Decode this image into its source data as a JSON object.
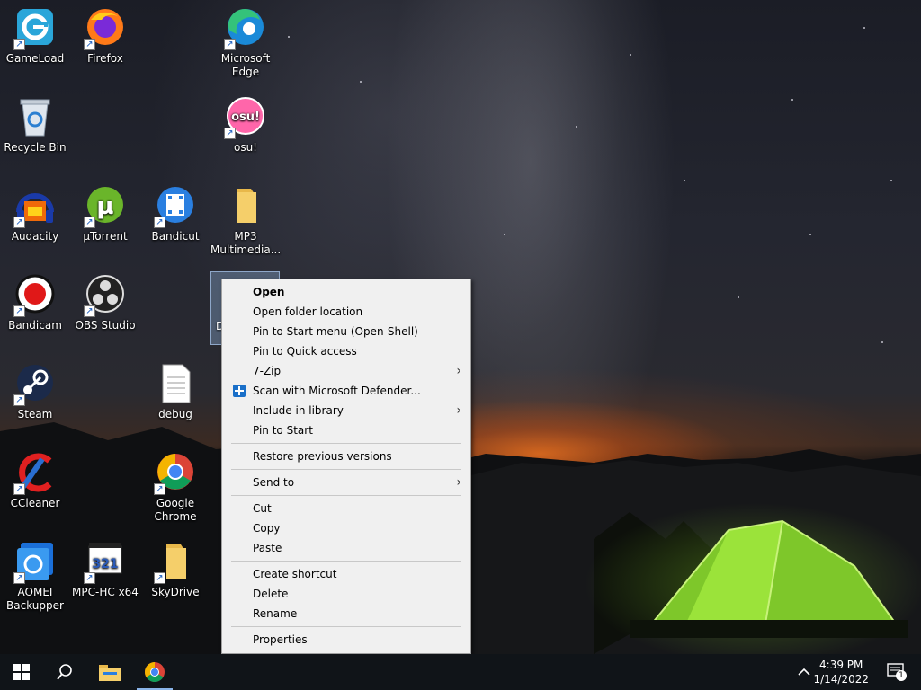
{
  "desktop": {
    "icons": [
      {
        "label": "GameLoad",
        "icon": "gameload-icon"
      },
      {
        "label": "Firefox",
        "icon": "firefox-icon"
      },
      {
        "label": "Microsoft Edge",
        "icon": "edge-icon"
      },
      {
        "label": "Recycle Bin",
        "icon": "recycle-bin-icon"
      },
      {
        "label": "osu!",
        "icon": "osu-icon"
      },
      {
        "label": "Audacity",
        "icon": "audacity-icon"
      },
      {
        "label": "µTorrent",
        "icon": "utorrent-icon"
      },
      {
        "label": "Bandicut",
        "icon": "bandicut-icon"
      },
      {
        "label": "MP3 Multimedia...",
        "icon": "folder-icon"
      },
      {
        "label": "Bandicam",
        "icon": "bandicam-icon"
      },
      {
        "label": "OBS Studio",
        "icon": "obs-icon"
      },
      {
        "label": "Steam",
        "icon": "steam-icon"
      },
      {
        "label": "debug",
        "icon": "text-file-icon"
      },
      {
        "label": "CCleaner",
        "icon": "ccleaner-icon"
      },
      {
        "label": "Google Chrome",
        "icon": "chrome-icon"
      },
      {
        "label": "AOMEI Backupper",
        "icon": "aomei-icon"
      },
      {
        "label": "MPC-HC x64",
        "icon": "mpc-hc-icon"
      },
      {
        "label": "SkyDrive",
        "icon": "folder-icon"
      }
    ],
    "selected_label": "D"
  },
  "context_menu": {
    "items": [
      {
        "label": "Open"
      },
      {
        "label": "Open folder location"
      },
      {
        "label": "Pin to Start menu (Open-Shell)"
      },
      {
        "label": "Pin to Quick access"
      },
      {
        "label": "7-Zip"
      },
      {
        "label": "Scan with Microsoft Defender..."
      },
      {
        "label": "Include in library"
      },
      {
        "label": "Pin to Start"
      },
      {
        "label": "Restore previous versions"
      },
      {
        "label": "Send to"
      },
      {
        "label": "Cut"
      },
      {
        "label": "Copy"
      },
      {
        "label": "Paste"
      },
      {
        "label": "Create shortcut"
      },
      {
        "label": "Delete"
      },
      {
        "label": "Rename"
      },
      {
        "label": "Properties"
      }
    ],
    "submenu_arrow": "›"
  },
  "taskbar": {
    "time": "4:39 PM",
    "date": "1/14/2022",
    "notification_count": "1",
    "tray_chevron": "^"
  },
  "colors": {
    "taskbar_bg": "#101418",
    "menu_bg": "#f0f0f0",
    "accent": "#0078d7"
  }
}
